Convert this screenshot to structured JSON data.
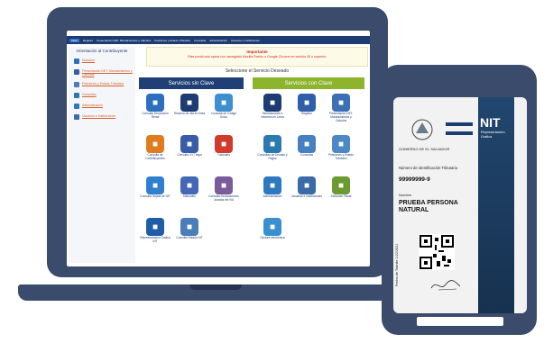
{
  "site": {
    "nav": [
      "Inicio",
      "Registro",
      "Presentación DET, Mandamientos y Cálculos",
      "Peticiones y Estado Tributario",
      "Consultas",
      "Administración",
      "Usuarios e Instituciones"
    ],
    "sidebar_title": "Orientación al Contribuyente",
    "sidebar_items": [
      "Nosotros",
      "Presentación DET, Mandamientos y Cálculos",
      "Peticiones y Estado Tributario",
      "Consultas",
      "Administración",
      "Usuarios e Instituciones"
    ],
    "notice_title": "Importante",
    "notice_text": "Este portal solo opera con navegador Mozilla Firefox o Google Chrome en versión 30 ó superior.",
    "select_title": "Seleccione el Servicio Deseado",
    "header_sin": "Servicios sin Clave",
    "header_con": "Servicios con Clave",
    "sin_services": [
      "Consulta Devolución Renta",
      "Reserva de cita en línea",
      "Consulta de Código Único",
      "Consulta de Contribuyentes",
      "Consulta CV7 legal",
      "Tutoriales",
      "Consulta Tarjeta de NIT",
      "Manuales",
      "Consulta Declaraciones Juradas del IVA",
      "Representación Gráfica NIT",
      "Consulta Estado NIT"
    ],
    "con_services": [
      "Declaraciones e Informes en Línea",
      "Registro",
      "Presentación DET, Mandamientos y Cálculos",
      "Consultas de Deudas y Pagos",
      "Consultas",
      "Peticiones y Estado Tributario",
      "Administración",
      "Usuarios e Instituciones",
      "Dictamen Fiscal",
      "Factura electrónica"
    ],
    "icon_colors": [
      "#2d6fbf",
      "#1d3c72",
      "#3d8fd0",
      "#e07b20",
      "#3a5ba8",
      "#d23a2a",
      "#2f7fd0",
      "#4467b8",
      "#7a5c9a",
      "#1f5da8",
      "#4b7db8"
    ],
    "con_icon_colors": [
      "#1d3c72",
      "#2f5fa8",
      "#3c6fb5",
      "#2a79b0",
      "#4680c0",
      "#4b88c5",
      "#2d79c0",
      "#3a6aa8",
      "#6a9a30",
      "#3a8fd0"
    ]
  },
  "card": {
    "title": "NIT",
    "subtitle": "Representación Gráfica",
    "gov": "GOBIERNO DE EL SALVADOR",
    "id_label": "Número de Identificación Tributaria",
    "id_value": "99999999-9",
    "name_label": "Nombre",
    "name_value": "PRUEBA PERSONA NATURAL",
    "date": "Fecha de Trámite 1/22/2021"
  }
}
